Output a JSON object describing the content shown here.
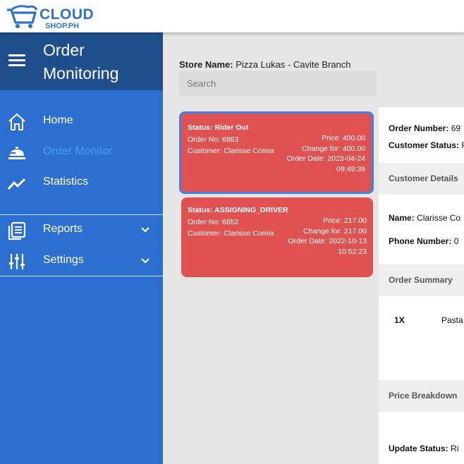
{
  "brand": {
    "name": "CLOUD",
    "sub": "SHOP.PH"
  },
  "sidebar": {
    "title": "Order Monitoring",
    "items": [
      {
        "label": "Home",
        "icon": "home-icon",
        "active": false
      },
      {
        "label": "Order Monitor",
        "icon": "food-tray-icon",
        "active": true
      },
      {
        "label": "Statistics",
        "icon": "chart-line-icon",
        "active": false
      },
      {
        "label": "Reports",
        "icon": "report-icon",
        "active": false,
        "expandable": true
      },
      {
        "label": "Settings",
        "icon": "sliders-icon",
        "active": false,
        "expandable": true
      }
    ]
  },
  "store": {
    "label": "Store Name:",
    "name": "Pizza Lukas - Cavite Branch"
  },
  "search": {
    "placeholder": "Search"
  },
  "orders": [
    {
      "status": "Status: Rider Out",
      "order_no": "Order No: 6983",
      "customer": "Customer: Clarisse Comia",
      "price": "Price: 400.00",
      "change_for": "Change for: 400.00",
      "order_date": "Order Date: 2023-04-24",
      "order_time": "09:49:39"
    },
    {
      "status": "Status: ASSIGNING_DRIVER",
      "order_no": "Order No: 6852",
      "customer": "Customer: Clarisse Comia",
      "price": "Price: 217.00",
      "change_for": "Change for: 217.00",
      "order_date": "Order Date: 2022-10-13",
      "order_time": "10:52:23"
    }
  ],
  "detail": {
    "order_number_label": "Order Number:",
    "order_number_value": "69",
    "customer_status_label": "Customer Status:",
    "customer_status_value": "R",
    "customer_details_header": "Customer Details",
    "name_label": "Name:",
    "name_value": "Clarisse Co",
    "phone_label": "Phone Number:",
    "phone_value": "0",
    "order_summary_header": "Order Summary",
    "item_qty": "1X",
    "item_name": "Pasta",
    "price_breakdown_header": "Price Breakdown",
    "update_status_label": "Update Status:",
    "update_status_value": "Ri"
  },
  "colors": {
    "sidebar": "#2d6fd1",
    "sidebar_head": "#1f4e8c",
    "card": "#e05252",
    "accent": "#4f9bff"
  }
}
